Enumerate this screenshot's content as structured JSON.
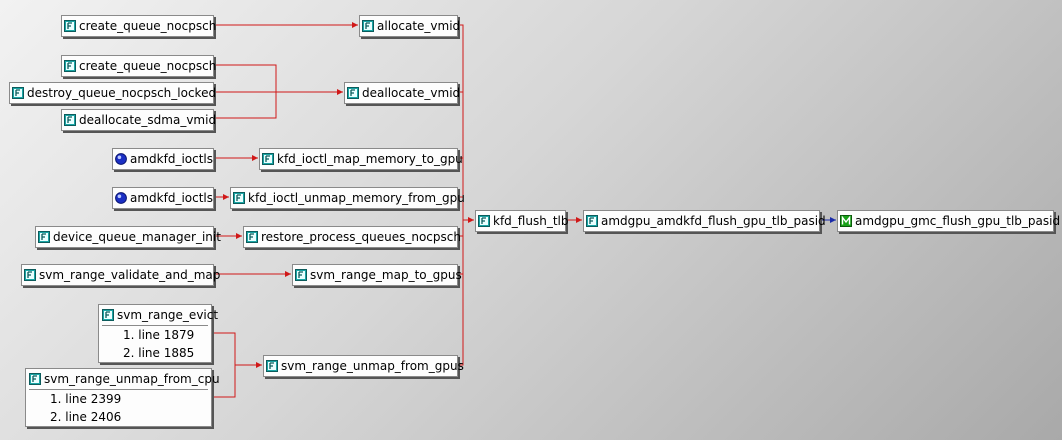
{
  "nodes": {
    "create_queue_1": "create_queue_nocpsch",
    "allocate_vmid": "allocate_vmid",
    "create_queue_2": "create_queue_nocpsch",
    "destroy_queue": "destroy_queue_nocpsch_locked",
    "deallocate_sdma": "deallocate_sdma_vmid",
    "deallocate_vmid": "deallocate_vmid",
    "amdkfd_ioctls_1": "amdkfd_ioctls",
    "map_memory": "kfd_ioctl_map_memory_to_gpu",
    "amdkfd_ioctls_2": "amdkfd_ioctls",
    "unmap_memory": "kfd_ioctl_unmap_memory_from_gpu",
    "kfd_flush_tlb": "kfd_flush_tlb",
    "flush_pasid": "amdgpu_amdkfd_flush_gpu_tlb_pasid",
    "gmc_flush": "amdgpu_gmc_flush_gpu_tlb_pasid",
    "dqm_init": "device_queue_manager_init",
    "restore_queues": "restore_process_queues_nocpsch",
    "validate_and_map": "svm_range_validate_and_map",
    "map_to_gpus": "svm_range_map_to_gpus",
    "svm_evict": {
      "name": "svm_range_evict",
      "lines": [
        "1. line 1879",
        "2. line 1885"
      ]
    },
    "svm_unmap_cpu": {
      "name": "svm_range_unmap_from_cpu",
      "lines": [
        "1. line 2399",
        "2. line 2406"
      ]
    },
    "unmap_from_gpus": "svm_range_unmap_from_gpus"
  },
  "colors": {
    "edge": "#d01818",
    "edge_highlight": "#1a2aa8",
    "icon_function": "#1aa6a6",
    "icon_macro": "#17a117",
    "icon_file": "#1b2fc4"
  },
  "icons": {
    "function": "function-icon",
    "macro": "macro-icon",
    "file": "source-file-icon"
  }
}
